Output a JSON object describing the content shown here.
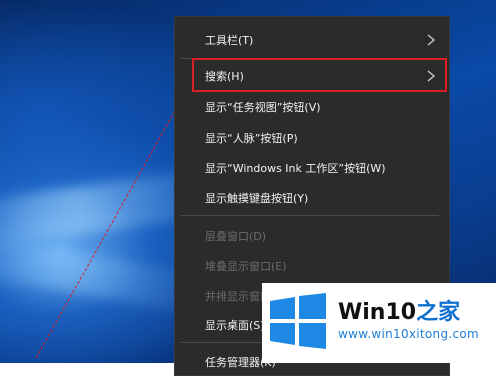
{
  "context_menu": {
    "items": [
      {
        "label": "工具栏(T)",
        "has_submenu": true,
        "enabled": true
      },
      {
        "label": "搜索(H)",
        "has_submenu": true,
        "enabled": true
      },
      {
        "label": "显示“任务视图”按钮(V)",
        "has_submenu": false,
        "enabled": true
      },
      {
        "label": "显示“人脉”按钮(P)",
        "has_submenu": false,
        "enabled": true
      },
      {
        "label": "显示“Windows Ink 工作区”按钮(W)",
        "has_submenu": false,
        "enabled": true
      },
      {
        "label": "显示触摸键盘按钮(Y)",
        "has_submenu": false,
        "enabled": true
      },
      {
        "label": "层叠窗口(D)",
        "has_submenu": false,
        "enabled": false
      },
      {
        "label": "堆叠显示窗口(E)",
        "has_submenu": false,
        "enabled": false
      },
      {
        "label": "并排显示窗口",
        "has_submenu": false,
        "enabled": false
      },
      {
        "label": "显示桌面(S)",
        "has_submenu": false,
        "enabled": true
      },
      {
        "label": "任务管理器(K)",
        "has_submenu": false,
        "enabled": true
      }
    ]
  },
  "watermark": {
    "brand_prefix": "Win10",
    "brand_suffix": "之家",
    "url": "www.win10xitong.com"
  },
  "colors": {
    "menu_background": "#2b2b2b",
    "menu_text": "#f2f2f2",
    "disabled_text": "#6b6b6b",
    "highlight_border": "#d81f26",
    "logo_blue": "#1e88e5",
    "url_blue": "#1f7fd6"
  },
  "icons": {
    "submenu": "chevron-right-icon",
    "logo": "windows-logo-icon"
  }
}
